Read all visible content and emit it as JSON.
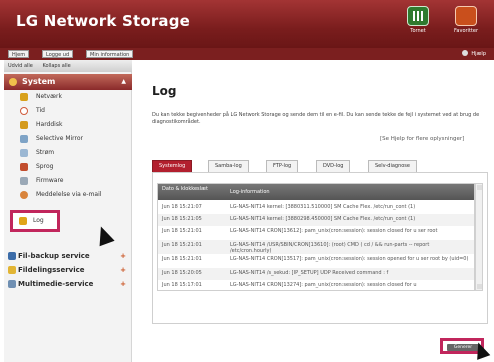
{
  "header": {
    "title": "LG Network Storage",
    "buttons": [
      {
        "label": "Tornet",
        "icon": "turret-icon"
      },
      {
        "label": "Favoritter",
        "icon": "favorites-icon"
      }
    ]
  },
  "topbar": {
    "links": [
      "Hjem",
      "Logge ud",
      "Min information"
    ],
    "help": "Hjælp"
  },
  "sidebar": {
    "expand_all": "Udvid alle",
    "collapse_all": "Kollaps alle",
    "system_header": "System",
    "items": [
      {
        "label": "Netværk",
        "icon": "network-icon"
      },
      {
        "label": "Tid",
        "icon": "clock-icon"
      },
      {
        "label": "Harddisk",
        "icon": "harddisk-icon"
      },
      {
        "label": "Selective Mirror",
        "icon": "mirror-icon"
      },
      {
        "label": "Strøm",
        "icon": "power-icon"
      },
      {
        "label": "Sprog",
        "icon": "language-icon"
      },
      {
        "label": "Firmware",
        "icon": "firmware-icon"
      },
      {
        "label": "Meddelelse via e-mail",
        "icon": "email-icon"
      },
      {
        "label": "Log",
        "icon": "log-icon"
      }
    ],
    "sections": [
      {
        "label": "Fil-backup service",
        "icon": "backup-icon"
      },
      {
        "label": "Fildelingsservice",
        "icon": "share-icon"
      },
      {
        "label": "Multimedie-service",
        "icon": "media-icon"
      }
    ]
  },
  "main": {
    "title": "Log",
    "description": "Du kan tekke begivenheder på LG Network Storage og sende dem til en e-fil. Du kan sende tekke de fejl i systemet ved at brug de diagnostikområdet.",
    "help_link": "[Se Hjelp for flere oplysninger]",
    "tabs": [
      "Systemlog",
      "Samba-log",
      "FTP-log",
      "DVD-log",
      "Selv-diagnose"
    ],
    "table": {
      "headers": [
        "Dato & klokkeslæt",
        "Log-information"
      ],
      "rows": [
        {
          "date": "Jun 18 15:21:07",
          "msg": "LG-NAS-NIT14 kernel: [3880311.510000] SM Cache Flex. /etc/run_cont (1)"
        },
        {
          "date": "Jun 18 15:21:05",
          "msg": "LG-NAS-NIT14 kernel: [3880298.450000] SM Cache Flex. /etc/run_cont (1)"
        },
        {
          "date": "Jun 18 15:21:01",
          "msg": "LG-NAS-NIT14 CRON[13612]: pam_unix(cron:session): session closed for u ser root"
        },
        {
          "date": "Jun 18 15:21:01",
          "msg": "LG-NAS-NIT14 /USR/SBIN/CRON[13610]: (root) CMD ( cd / && run-parts -- report /etc/cron.hourly)"
        },
        {
          "date": "Jun 18 15:21:01",
          "msg": "LG-NAS-NIT14 CRON[13517]: pam_unix(cron:session): session opened for u ser root by (uid=0)"
        },
        {
          "date": "Jun 18 15:20:05",
          "msg": "LG-NAS-NIT14 /s_sekud: [IP_SETUP] UDP Received command : f"
        },
        {
          "date": "Jun 18 15:17:01",
          "msg": "LG-NAS-NIT14 CRON[13274]: pam_unix(cron:session): session closed for u"
        }
      ]
    },
    "generate_button": "Generer"
  }
}
